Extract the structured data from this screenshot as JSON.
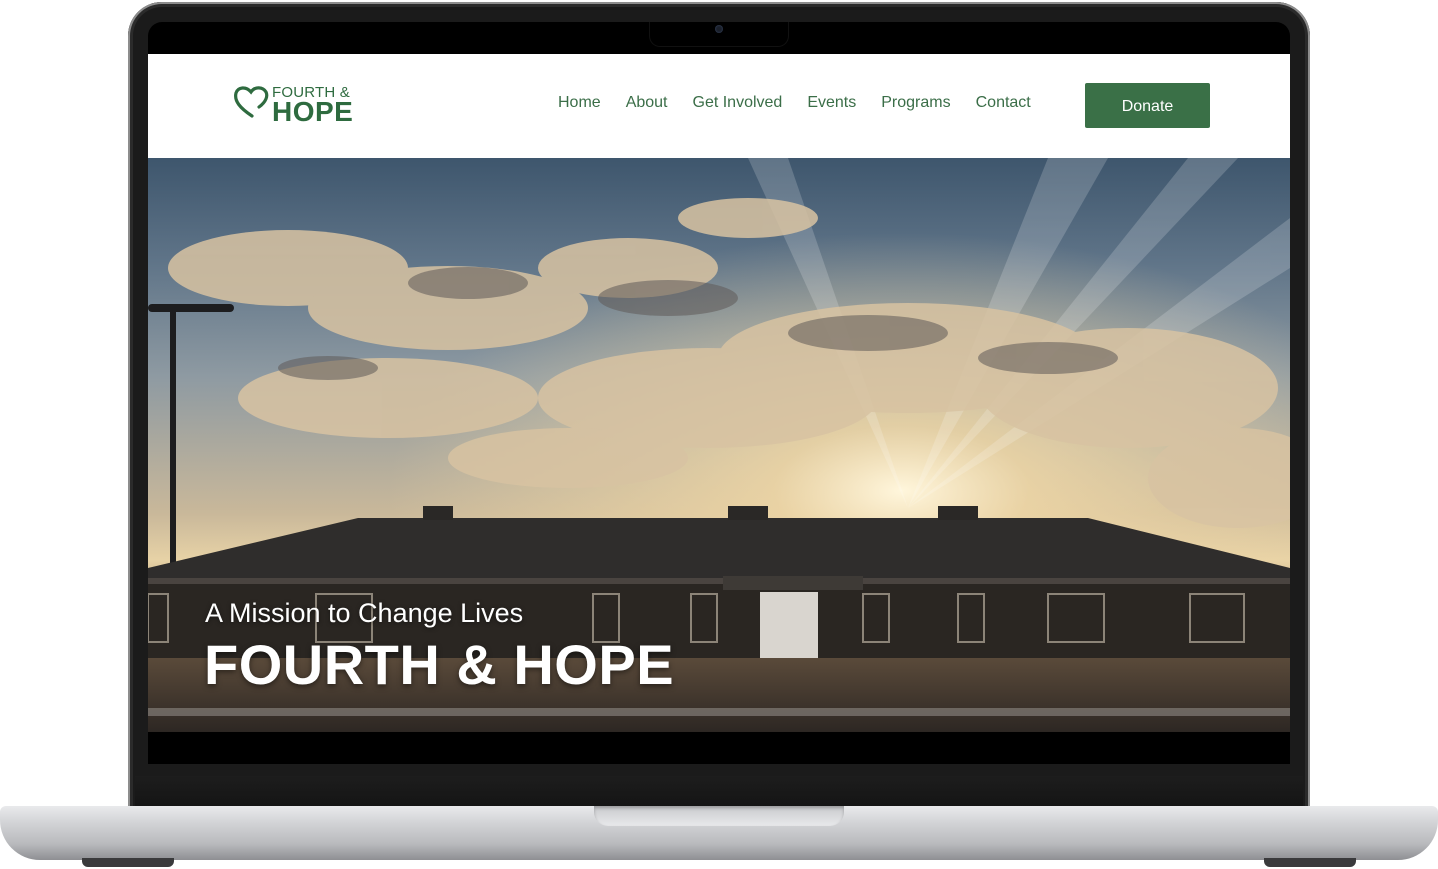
{
  "header": {
    "logo": {
      "line1": "FOURTH &",
      "line2": "HOPE"
    },
    "nav": [
      {
        "label": "Home"
      },
      {
        "label": "About"
      },
      {
        "label": "Get Involved"
      },
      {
        "label": "Events"
      },
      {
        "label": "Programs"
      },
      {
        "label": "Contact"
      }
    ],
    "donate_label": "Donate"
  },
  "hero": {
    "subtitle": "A Mission to Change Lives",
    "title": "FOURTH & HOPE"
  },
  "colors": {
    "brand_green": "#3a7047",
    "nav_text": "#3b6e48",
    "header_bg": "#ffffff"
  },
  "icons": [
    "heart-logo-icon"
  ]
}
